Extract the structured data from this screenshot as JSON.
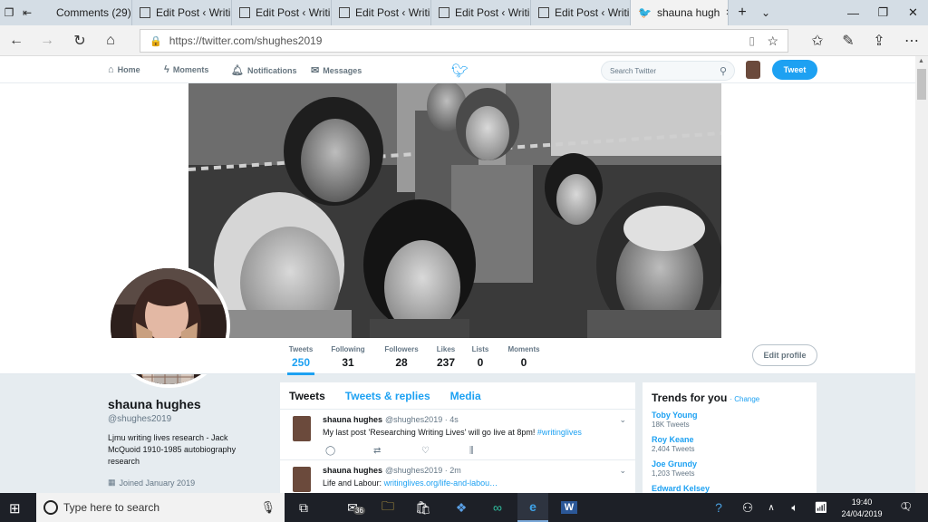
{
  "browser": {
    "tabs": [
      {
        "label": "Comments (29) ‹",
        "active": false
      },
      {
        "label": "Edit Post ‹ Writir",
        "active": false
      },
      {
        "label": "Edit Post ‹ Writir",
        "active": false
      },
      {
        "label": "Edit Post ‹ Writir",
        "active": false
      },
      {
        "label": "Edit Post ‹ Writir",
        "active": false
      },
      {
        "label": "Edit Post ‹ Writir",
        "active": false
      },
      {
        "label": "shauna hugh",
        "active": true
      }
    ],
    "url": "https://twitter.com/shughes2019"
  },
  "nav": {
    "home": "Home",
    "moments": "Moments",
    "notifications": "Notifications",
    "messages": "Messages",
    "search_placeholder": "Search Twitter",
    "tweet_button": "Tweet"
  },
  "profile": {
    "name": "shauna hughes",
    "handle": "@shughes2019",
    "bio": "Ljmu writing lives research - Jack McQuoid 1910-1985 autobiography research",
    "joined": "Joined January 2019",
    "edit_button": "Edit profile",
    "stats": [
      {
        "label": "Tweets",
        "value": "250"
      },
      {
        "label": "Following",
        "value": "31"
      },
      {
        "label": "Followers",
        "value": "28"
      },
      {
        "label": "Likes",
        "value": "237"
      },
      {
        "label": "Lists",
        "value": "0"
      },
      {
        "label": "Moments",
        "value": "0"
      }
    ]
  },
  "timeline": {
    "tabs": [
      "Tweets",
      "Tweets & replies",
      "Media"
    ],
    "tweets": [
      {
        "name": "shauna hughes",
        "meta": "@shughes2019 · 4s",
        "text": "My last post 'Researching Writing Lives' will go live at 8pm! ",
        "link": "#writinglives"
      },
      {
        "name": "shauna hughes",
        "meta": "@shughes2019 · 2m",
        "text": "Life and Labour: ",
        "link": "writinglives.org/life-and-labou…"
      }
    ]
  },
  "trends": {
    "title": "Trends for you",
    "change": "· Change",
    "items": [
      {
        "name": "Toby Young",
        "count": "18K Tweets"
      },
      {
        "name": "Roy Keane",
        "count": "2,404 Tweets"
      },
      {
        "name": "Joe Grundy",
        "count": "1,203 Tweets"
      },
      {
        "name": "Edward Kelsey",
        "count": ""
      }
    ]
  },
  "taskbar": {
    "search_placeholder": "Type here to search",
    "mail_badge": "36",
    "time": "19:40",
    "date": "24/04/2019",
    "notification_count": "1"
  },
  "colors": {
    "accent": "#1da1f2",
    "taskbar": "#1d2027"
  }
}
